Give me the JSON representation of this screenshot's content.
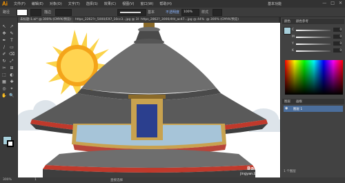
{
  "app": {
    "logo": "Ai"
  },
  "menu": {
    "items": [
      "文件(F)",
      "编辑(E)",
      "对象(O)",
      "文字(T)",
      "选择(S)",
      "效果(C)",
      "视图(V)",
      "窗口(W)",
      "帮助(H)"
    ]
  },
  "workspace": {
    "label": "基本功能"
  },
  "window_controls": {
    "minimize": "—",
    "maximize": "□",
    "close": "✕"
  },
  "control_bar": {
    "object_label": "路径",
    "stroke_label": "描边",
    "stroke_style": "基本",
    "opacity_label": "不透明度",
    "opacity_value": "100%",
    "style_label": "样式"
  },
  "tabs": [
    {
      "label": "未标题-1.ai* @ 300% (CMYK/预览)"
    },
    {
      "label": "https_2262?r_5000/E97_10cc3...jpg @ 300%"
    },
    {
      "label": "https_2862?_3000/4fd_ac47...jpg @ 44%"
    },
    {
      "label": "@ 300% (CMYK/预览)"
    }
  ],
  "tools": [
    "↖",
    "↗",
    "✥",
    "✎",
    "✒",
    "T",
    "/",
    "▭",
    "✐",
    "⌫",
    "↻",
    "⤢",
    "✂",
    "⊞",
    "⬚",
    "◐",
    "▦",
    "✚",
    "◎",
    "⌖",
    "✋",
    "🔍"
  ],
  "status": {
    "zoom": "300%",
    "page": "1",
    "mode": "直接选择"
  },
  "color_panel": {
    "tab1": "颜色",
    "tab2": "颜色参考",
    "channels": [
      "C",
      "M",
      "Y",
      "K"
    ],
    "values": [
      "0",
      "0",
      "0",
      "0"
    ]
  },
  "layers_panel": {
    "tab1": "图层",
    "tab2": "画板",
    "layer_name": "图层 1",
    "count_label": "1 个图层"
  },
  "colors": {
    "accent": "#ff9a00",
    "sky_blue": "#2b3f8e",
    "roof_red": "#c0392b",
    "gold": "#c8a24f"
  },
  "watermark": {
    "text": "Baidu 经验",
    "url": "jingyan.baidu.com"
  }
}
